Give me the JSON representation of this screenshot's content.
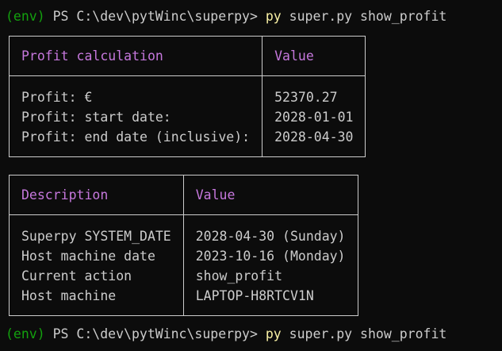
{
  "prompts": [
    {
      "env": "(env)",
      "ps": "PS C:\\dev\\pytWinc\\superpy>",
      "cmd": "py",
      "args": "super.py show_profit"
    },
    {
      "env": "(env)",
      "ps": "PS C:\\dev\\pytWinc\\superpy>",
      "cmd": "py",
      "args": "super.py show_profit"
    }
  ],
  "profit_table": {
    "headers": [
      "Profit calculation",
      "Value"
    ],
    "rows": [
      [
        "Profit: €",
        "52370.27"
      ],
      [
        "Profit: start date:",
        "2028-01-01"
      ],
      [
        "Profit: end date (inclusive):",
        "2028-04-30"
      ]
    ]
  },
  "info_table": {
    "headers": [
      "Description",
      "Value"
    ],
    "rows": [
      [
        "Superpy SYSTEM_DATE",
        "2028-04-30 (Sunday)"
      ],
      [
        "Host machine date",
        "2023-10-16 (Monday)"
      ],
      [
        "Current action",
        "show_profit"
      ],
      [
        "Host machine",
        "LAPTOP-H8RTCV1N"
      ]
    ]
  },
  "colors": {
    "background": "#0c0c0c",
    "text": "#cccccc",
    "env": "#13a10e",
    "command": "#f9f1a5",
    "header": "#c678dd"
  }
}
